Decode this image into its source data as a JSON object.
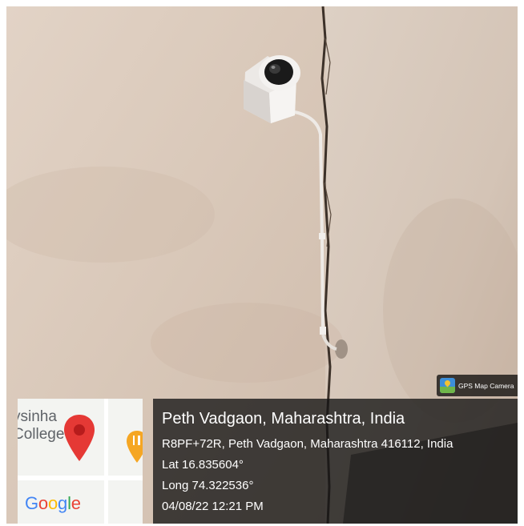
{
  "badge": {
    "label": "GPS Map Camera",
    "icon": "gps-map-camera-app-icon"
  },
  "map": {
    "place_label": "ysinha\nCollege",
    "logo_letters": [
      "G",
      "o",
      "o",
      "g",
      "l",
      "e"
    ],
    "marker_color": "#e53935",
    "poi_color": "#f5a623"
  },
  "info": {
    "title": "Peth Vadgaon, Maharashtra, India",
    "address": "R8PF+72R, Peth Vadgaon, Maharashtra 416112, India",
    "latitude": "Lat 16.835604°",
    "longitude": "Long 74.322536°",
    "datetime": "04/08/22 12:21 PM"
  },
  "colors": {
    "wall": "#d8c9bb",
    "panel": "#141414"
  }
}
